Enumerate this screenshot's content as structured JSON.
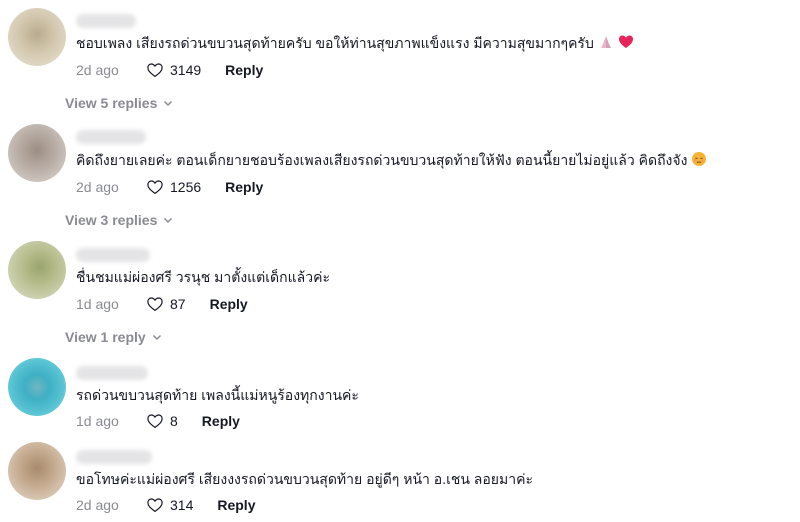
{
  "comments": [
    {
      "text": "ชอบเพลง เสียงรถด่วนขบวนสุดท้ายครับ ขอให้ท่านสุขภาพแข็งแรง มีความสุขมากๆครับ",
      "date": "2d ago",
      "likes": "3149",
      "reply_label": "Reply",
      "view_replies": "View 5 replies",
      "emojis": [
        "praying-hands-icon",
        "heart-icon"
      ]
    },
    {
      "text": "คิดถึงยายเลยค่ะ ตอนเด็กยายชอบร้องเพลงเสียงรถด่วนขบวนสุดท้ายให้ฟัง ตอนนี้ยายไม่อยู่แล้ว คิดถึงจัง",
      "date": "2d ago",
      "likes": "1256",
      "reply_label": "Reply",
      "view_replies": "View 3 replies",
      "emojis": [
        "pensive-face-icon"
      ]
    },
    {
      "text": "ชื่นชมแม่ผ่องศรี วรนุช มาตั้งแต่เด็กแล้วค่ะ",
      "date": "1d ago",
      "likes": "87",
      "reply_label": "Reply",
      "view_replies": "View 1 reply"
    },
    {
      "text": "รถด่วนขบวนสุดท้าย เพลงนี้แม่หนูร้องทุกงานค่ะ",
      "date": "1d ago",
      "likes": "8",
      "reply_label": "Reply"
    },
    {
      "text": "ขอโทษค่ะแม่ผ่องศรี เสียงงงรถด่วนขบวนสุดท้าย อยู่ดีๆ หน้า อ.เชน ลอยมาค่ะ",
      "date": "2d ago",
      "likes": "314",
      "reply_label": "Reply"
    }
  ],
  "colors": {
    "text": "#161823",
    "muted": "#8a8b91",
    "like_outline": "#161823",
    "heart_emoji": "#e6245c"
  }
}
